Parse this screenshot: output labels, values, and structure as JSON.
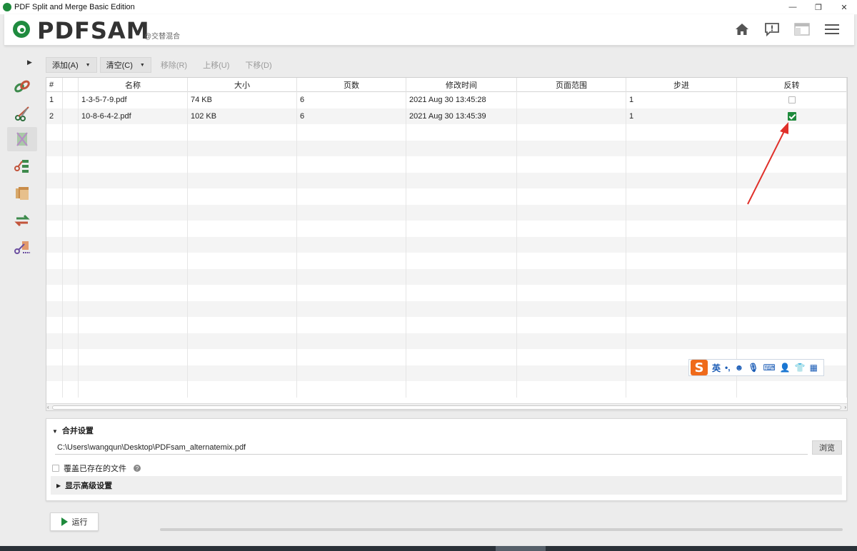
{
  "window": {
    "title": "PDF Split and Merge Basic Edition",
    "controls": {
      "minimize": "—",
      "restore": "❐",
      "close": "✕"
    }
  },
  "header": {
    "logo": "PDFSAM",
    "subtitle": "@交替混合",
    "icons": [
      "home-icon",
      "feedback-icon",
      "dashboard-icon",
      "menu-icon"
    ]
  },
  "toolbar": {
    "add": "添加(A)",
    "clear": "清空(C)",
    "remove": "移除(R)",
    "move_up": "上移(U)",
    "move_down": "下移(D)"
  },
  "table": {
    "columns": [
      "#",
      "",
      "名称",
      "大小",
      "页数",
      "修改时间",
      "页面范围",
      "步进",
      "反转"
    ],
    "rows": [
      {
        "index": "1",
        "name": "1-3-5-7-9.pdf",
        "size": "74 KB",
        "pages": "6",
        "modified": "2021 Aug 30 13:45:28",
        "range": "",
        "step": "1",
        "reverse": false
      },
      {
        "index": "2",
        "name": "10-8-6-4-2.pdf",
        "size": "102 KB",
        "pages": "6",
        "modified": "2021 Aug 30 13:45:39",
        "range": "",
        "step": "1",
        "reverse": true
      }
    ]
  },
  "ime": {
    "mode": "英",
    "punct": "•,",
    "logo": "S"
  },
  "settings": {
    "title": "合并设置",
    "output_path": "C:\\Users\\wangqun\\Desktop\\PDFsam_alternatemix.pdf",
    "browse": "浏览",
    "overwrite_label": "覆盖已存在的文件",
    "help": "?",
    "advanced": "显示高级设置"
  },
  "run": {
    "label": "运行"
  },
  "colors": {
    "accent": "#1e8a3c",
    "annotation": "#e0302a",
    "ime": "#ef6a1a"
  }
}
